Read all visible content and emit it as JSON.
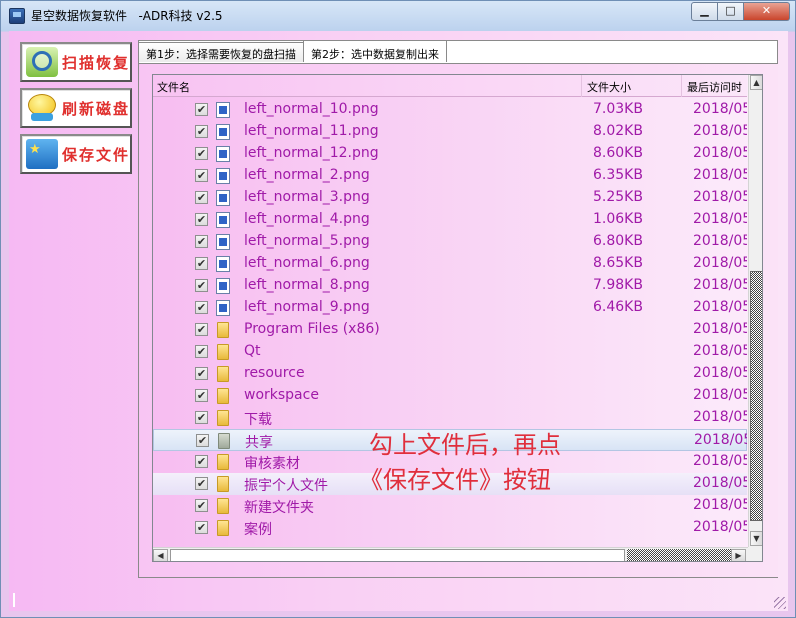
{
  "window": {
    "title": "星空数据恢复软件   -ADR科技 v2.5",
    "min_glyph": "▁",
    "max_glyph": "□",
    "close_glyph": "✕"
  },
  "sidebar": {
    "buttons": [
      {
        "label": "扫描恢复",
        "icon": "magnifier-scan-icon"
      },
      {
        "label": "刷新磁盘",
        "icon": "refresh-disk-icon"
      },
      {
        "label": "保存文件",
        "icon": "save-file-icon"
      }
    ]
  },
  "tabs": [
    {
      "label": "第1步：选择需要恢复的盘扫描",
      "active": false
    },
    {
      "label": "第2步：选中数据复制出来",
      "active": true
    }
  ],
  "list": {
    "columns": {
      "name": "文件名",
      "size": "文件大小",
      "date": "最后访问时"
    },
    "rows": [
      {
        "type": "png",
        "name": "left_normal_10.png",
        "size": "7.03KB",
        "date": "2018/05"
      },
      {
        "type": "png",
        "name": "left_normal_11.png",
        "size": "8.02KB",
        "date": "2018/05"
      },
      {
        "type": "png",
        "name": "left_normal_12.png",
        "size": "8.60KB",
        "date": "2018/05"
      },
      {
        "type": "png",
        "name": "left_normal_2.png",
        "size": "6.35KB",
        "date": "2018/05"
      },
      {
        "type": "png",
        "name": "left_normal_3.png",
        "size": "5.25KB",
        "date": "2018/05"
      },
      {
        "type": "png",
        "name": "left_normal_4.png",
        "size": "1.06KB",
        "date": "2018/05"
      },
      {
        "type": "png",
        "name": "left_normal_5.png",
        "size": "6.80KB",
        "date": "2018/05"
      },
      {
        "type": "png",
        "name": "left_normal_6.png",
        "size": "8.65KB",
        "date": "2018/05"
      },
      {
        "type": "png",
        "name": "left_normal_8.png",
        "size": "7.98KB",
        "date": "2018/05"
      },
      {
        "type": "png",
        "name": "left_normal_9.png",
        "size": "6.46KB",
        "date": "2018/05"
      },
      {
        "type": "folder",
        "name": "Program Files (x86)",
        "size": "",
        "date": "2018/05"
      },
      {
        "type": "folder",
        "name": "Qt",
        "size": "",
        "date": "2018/05"
      },
      {
        "type": "folder",
        "name": "resource",
        "size": "",
        "date": "2018/05"
      },
      {
        "type": "folder",
        "name": "workspace",
        "size": "",
        "date": "2018/05"
      },
      {
        "type": "folder",
        "name": "下载",
        "size": "",
        "date": "2018/05"
      },
      {
        "type": "folder-shared",
        "name": "共享",
        "size": "",
        "date": "2018/05",
        "highlight": "selected"
      },
      {
        "type": "folder",
        "name": "审核素材",
        "size": "",
        "date": "2018/05"
      },
      {
        "type": "folder",
        "name": "振宇个人文件",
        "size": "",
        "date": "2018/05",
        "highlight": "hover"
      },
      {
        "type": "folder",
        "name": "新建文件夹",
        "size": "",
        "date": "2018/05"
      },
      {
        "type": "folder",
        "name": "案例",
        "size": "",
        "date": "2018/05"
      }
    ],
    "check_glyph": "✔"
  },
  "annotation": {
    "line1": "勾上文件后，再点",
    "line2": "《保存文件》按钮"
  },
  "colors": {
    "button_text": "#e0302e",
    "row_text": "#a01aa8",
    "annotation": "#e02f3c",
    "bg_pink": "#f6b9f3"
  }
}
